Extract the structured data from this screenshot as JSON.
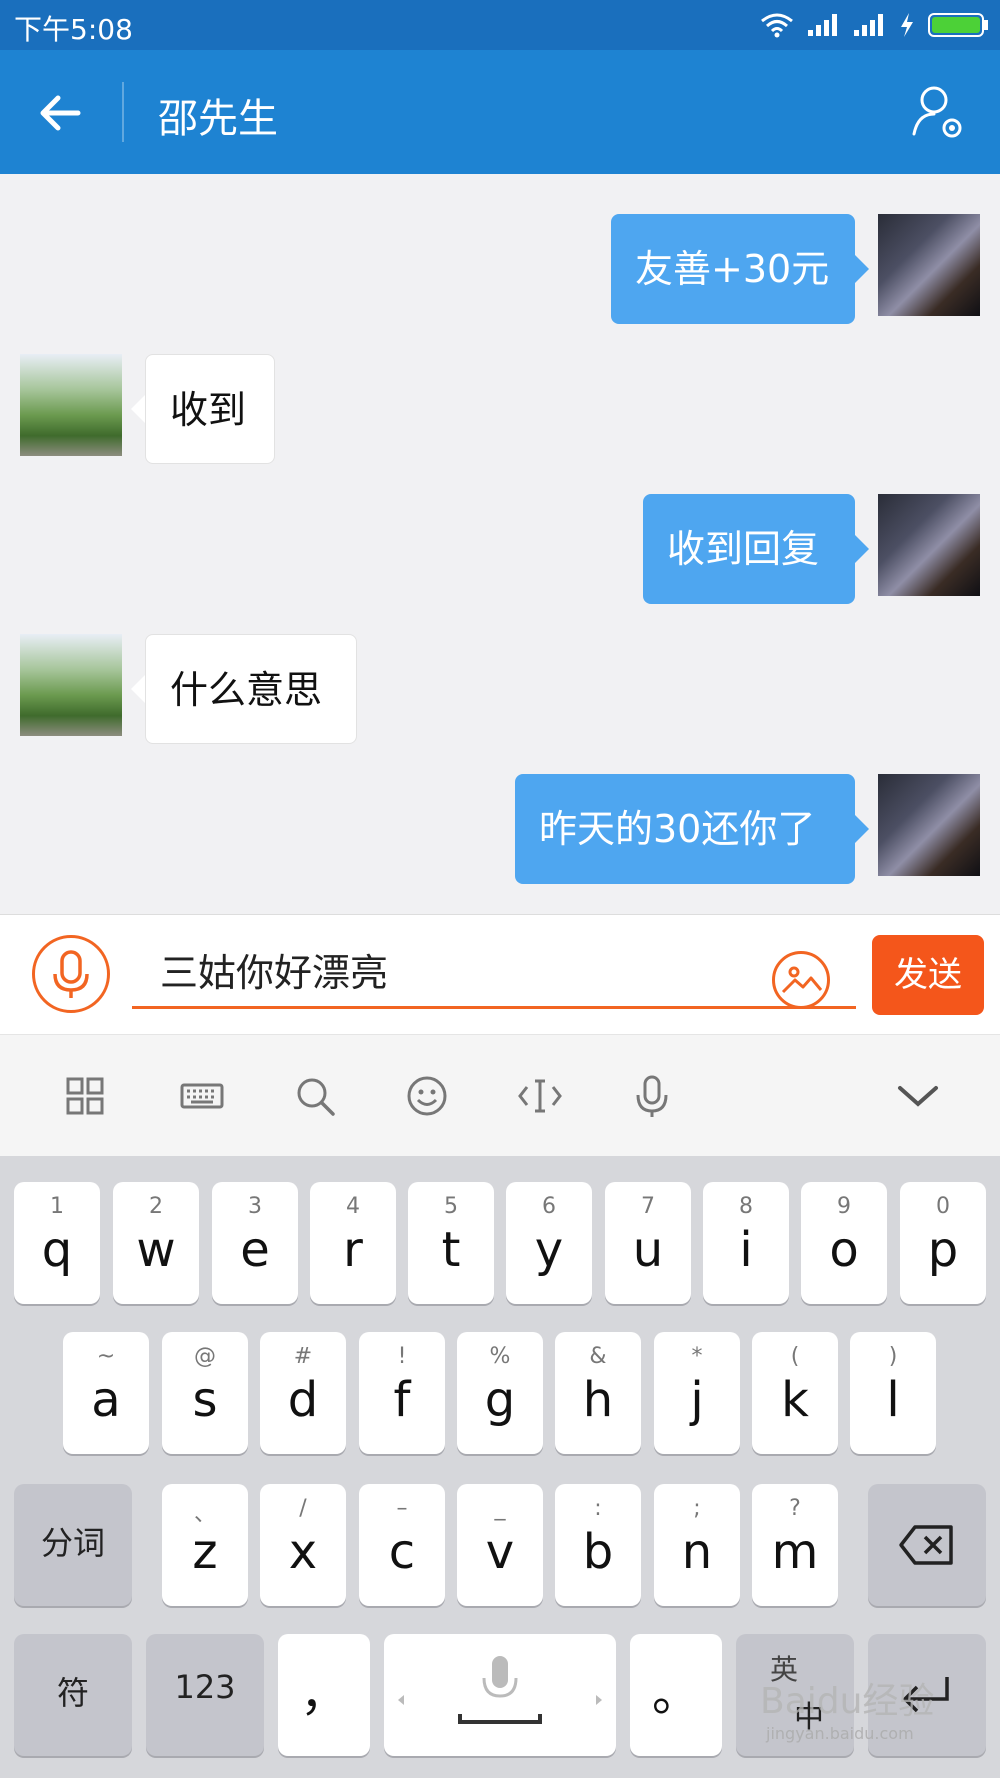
{
  "status_bar": {
    "time": "下午5:08"
  },
  "header": {
    "title": "邵先生"
  },
  "messages": [
    {
      "side": "right",
      "text": "友善+30元"
    },
    {
      "side": "left",
      "text": "收到"
    },
    {
      "side": "right",
      "text": "收到回复"
    },
    {
      "side": "left",
      "text": "什么意思"
    },
    {
      "side": "right",
      "text": "昨天的30还你了"
    }
  ],
  "composer": {
    "input_value": "三姑你好漂亮",
    "send_label": "发送"
  },
  "keyboard": {
    "row1": [
      {
        "sub": "1",
        "main": "q"
      },
      {
        "sub": "2",
        "main": "w"
      },
      {
        "sub": "3",
        "main": "e"
      },
      {
        "sub": "4",
        "main": "r"
      },
      {
        "sub": "5",
        "main": "t"
      },
      {
        "sub": "6",
        "main": "y"
      },
      {
        "sub": "7",
        "main": "u"
      },
      {
        "sub": "8",
        "main": "i"
      },
      {
        "sub": "9",
        "main": "o"
      },
      {
        "sub": "0",
        "main": "p"
      }
    ],
    "row2": [
      {
        "sub": "~",
        "main": "a"
      },
      {
        "sub": "@",
        "main": "s"
      },
      {
        "sub": "#",
        "main": "d"
      },
      {
        "sub": "!",
        "main": "f"
      },
      {
        "sub": "%",
        "main": "g"
      },
      {
        "sub": "&",
        "main": "h"
      },
      {
        "sub": "*",
        "main": "j"
      },
      {
        "sub": "(",
        "main": "k"
      },
      {
        "sub": ")",
        "main": "l"
      }
    ],
    "row3": [
      {
        "sub": "、",
        "main": "z"
      },
      {
        "sub": "/",
        "main": "x"
      },
      {
        "sub": "–",
        "main": "c"
      },
      {
        "sub": "_",
        "main": "v"
      },
      {
        "sub": ":",
        "main": "b"
      },
      {
        "sub": ";",
        "main": "n"
      },
      {
        "sub": "?",
        "main": "m"
      }
    ],
    "split_label": "分词",
    "symbol_label": "符",
    "num_label": "123",
    "comma_label": "，",
    "period_label": "。",
    "lang_top": "英",
    "lang_bottom": "中"
  },
  "watermark": {
    "main": "Baidu经验",
    "sub": "jingyan.baidu.com"
  }
}
